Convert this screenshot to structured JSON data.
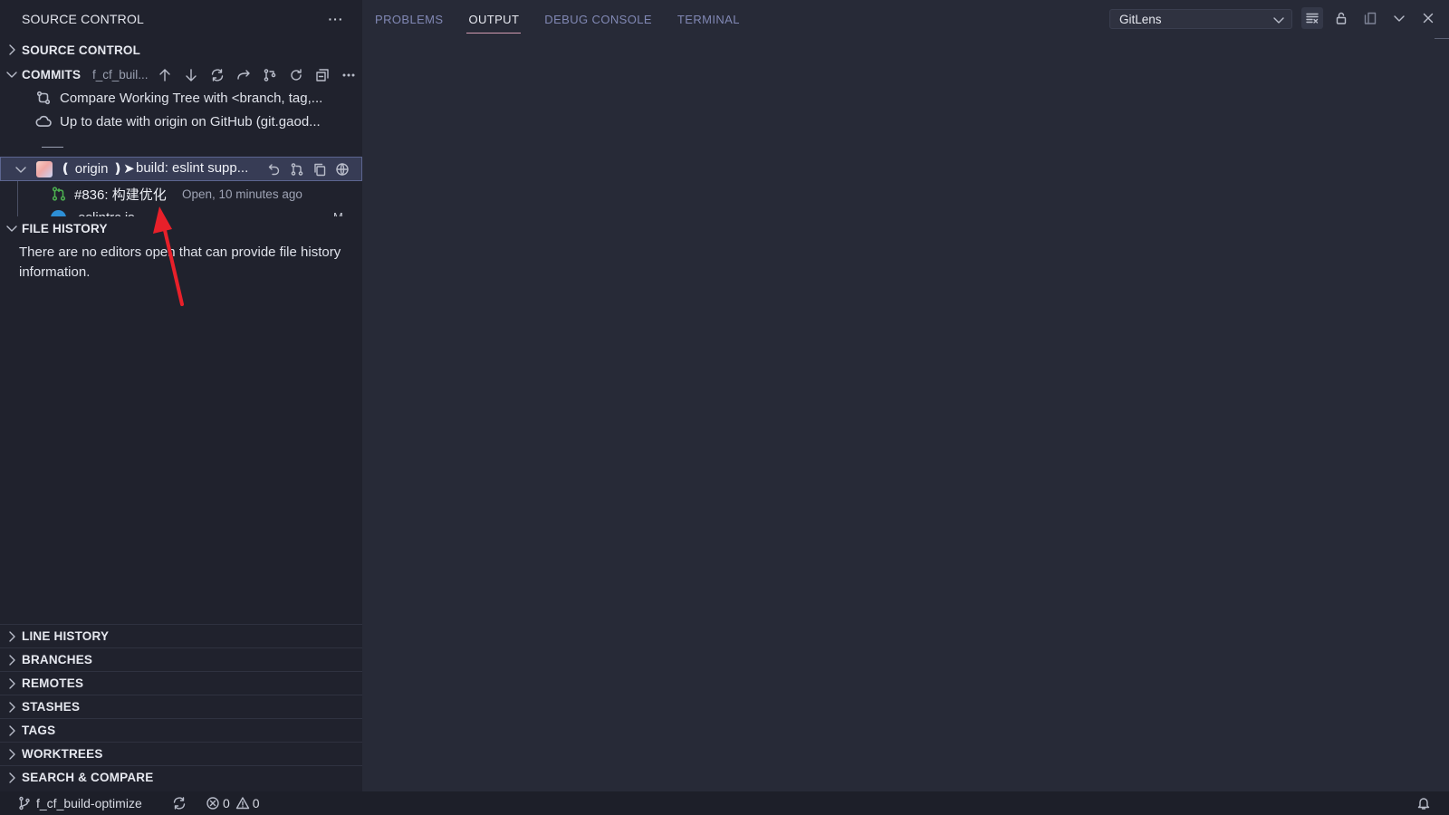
{
  "sidebar": {
    "title": "SOURCE CONTROL",
    "more_label": "···",
    "source_control_section": "SOURCE CONTROL",
    "commits": {
      "label": "COMMITS",
      "branch_short": "f_cf_buil...",
      "items": [
        {
          "icon": "compare-icon",
          "text": "Compare Working Tree with <branch, tag,..."
        },
        {
          "icon": "cloud-icon",
          "text": "Up to date with origin on GitHub (git.gaod..."
        }
      ],
      "selected_commit": {
        "origin_text": "❪ origin ❫➤",
        "message": "build: eslint supp..."
      },
      "pull_request": {
        "title": "#836: 构建优化",
        "status": "Open, 10 minutes ago"
      },
      "partial_file": ".eslintrc.js",
      "partial_file_status": "M"
    },
    "file_history": {
      "label": "FILE HISTORY",
      "message": "There are no editors open that can provide file history information."
    },
    "sections": [
      "LINE HISTORY",
      "BRANCHES",
      "REMOTES",
      "STASHES",
      "TAGS",
      "WORKTREES",
      "SEARCH & COMPARE"
    ]
  },
  "panel": {
    "tabs": [
      {
        "label": "PROBLEMS",
        "active": false
      },
      {
        "label": "OUTPUT",
        "active": true
      },
      {
        "label": "DEBUG CONSOLE",
        "active": false
      },
      {
        "label": "TERMINAL",
        "active": false
      }
    ],
    "output_channel": "GitLens"
  },
  "statusbar": {
    "branch": "f_cf_build-optimize",
    "errors": "0",
    "warnings": "0"
  },
  "colors": {
    "sidebar_bg": "#20222d",
    "panel_bg": "#272a37",
    "selection_bg": "#373c55",
    "active_tab_underline": "#d29bb2",
    "pr_icon": "#4caf50",
    "annotation_arrow": "#e8202a"
  }
}
